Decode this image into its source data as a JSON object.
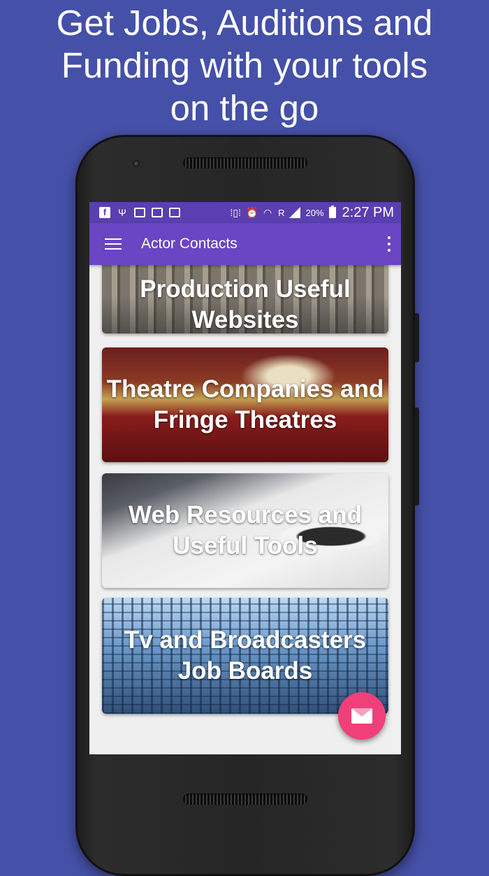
{
  "headline": {
    "line1": "Get Jobs, Auditions and",
    "line2": "Funding with your tools",
    "line3": "on the go"
  },
  "status_bar": {
    "battery_percent": "20%",
    "network_label": "R",
    "time": "2:27 PM",
    "icons": [
      "facebook-icon",
      "usb-icon",
      "email-icon",
      "image-icon",
      "clipboard-check-icon",
      "vibrate-icon",
      "alarm-icon",
      "wifi-icon",
      "signal-icon",
      "battery-charging-icon"
    ]
  },
  "app_bar": {
    "title": "Actor Contacts",
    "menu_icon": "hamburger-menu-icon",
    "overflow_icon": "more-vert-icon"
  },
  "cards": [
    {
      "label": "Production Useful Websites",
      "image": "city-street-photo"
    },
    {
      "label": "Theatre Companies and Fringe Theatres",
      "image": "theatre-auditorium-photo"
    },
    {
      "label": "Web Resources and Useful Tools",
      "image": "tablet-coffee-desk-photo"
    },
    {
      "label": "Tv and Broadcasters Job Boards",
      "image": "glass-office-building-photo"
    }
  ],
  "fab": {
    "icon": "email-icon"
  },
  "colors": {
    "background": "#4550a8",
    "status_bar": "#5a3fb0",
    "app_bar": "#6a45c4",
    "fab": "#f0407a"
  }
}
